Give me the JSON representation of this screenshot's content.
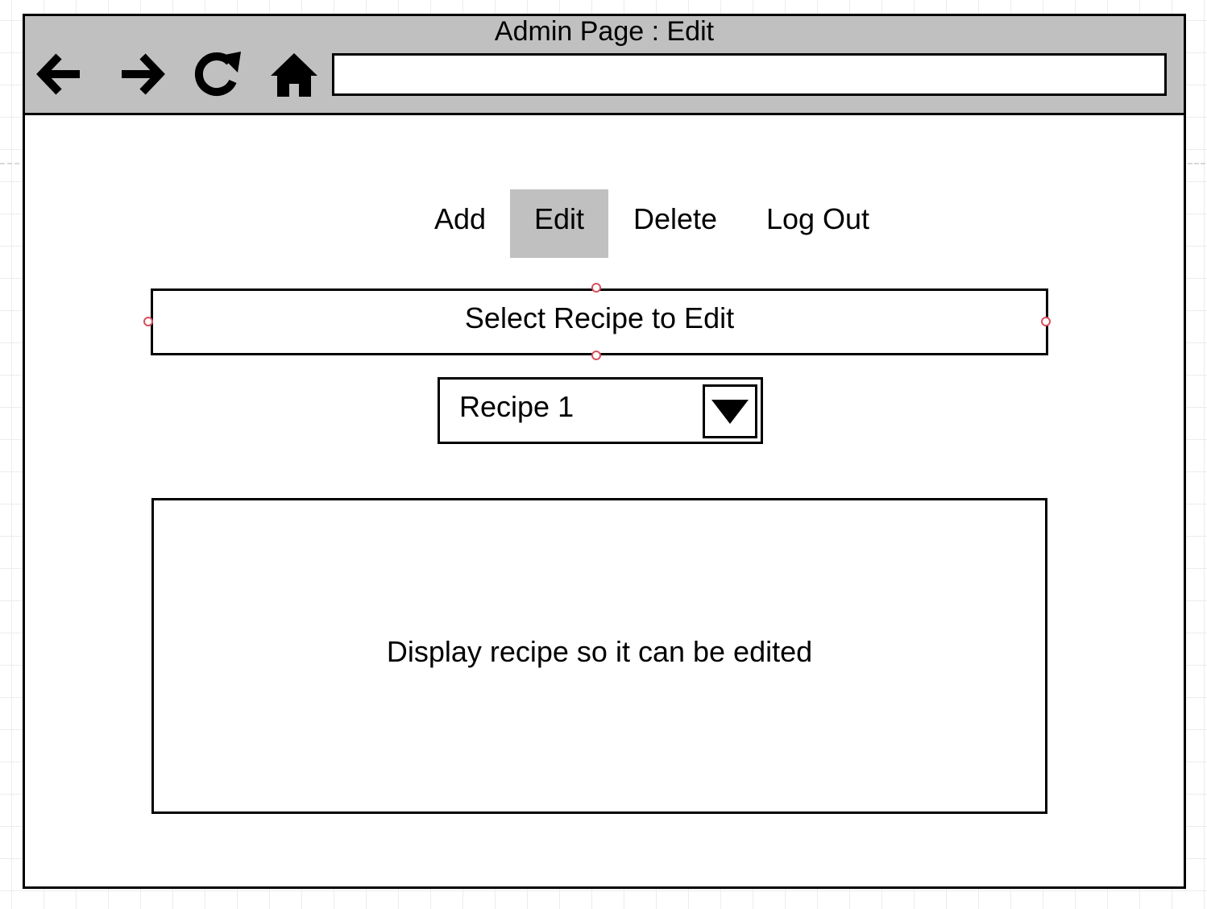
{
  "window": {
    "title": "Admin Page : Edit",
    "address_value": ""
  },
  "toolbar": {
    "icons": [
      "back-arrow-icon",
      "forward-arrow-icon",
      "reload-icon",
      "home-icon"
    ]
  },
  "menu": {
    "items": [
      {
        "label": "Add",
        "active": false
      },
      {
        "label": "Edit",
        "active": true
      },
      {
        "label": "Delete",
        "active": false
      },
      {
        "label": "Log Out",
        "active": false
      }
    ]
  },
  "header": {
    "label": "Select Recipe to Edit"
  },
  "recipe_select": {
    "value": "Recipe 1"
  },
  "content": {
    "placeholder": "Display recipe so it can be edited"
  },
  "colors": {
    "toolbar_bg": "#c0c0c0",
    "active_tab_bg": "#c0c0c0",
    "border": "#000000",
    "selection_handle": "#d6505c"
  }
}
